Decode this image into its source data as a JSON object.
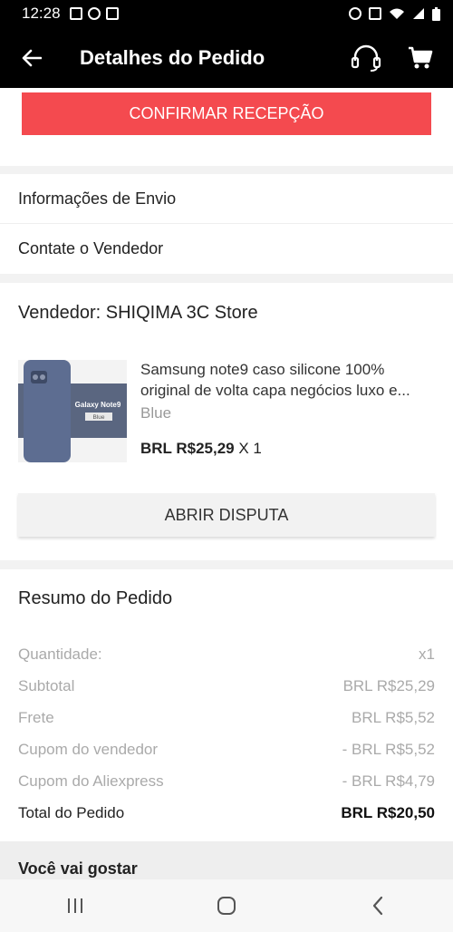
{
  "status_bar": {
    "time": "12:28"
  },
  "app_bar": {
    "title": "Detalhes do Pedido"
  },
  "actions": {
    "confirm_label": "CONFIRMAR RECEPÇÃO"
  },
  "links": [
    {
      "label": "Informações de Envio"
    },
    {
      "label": "Contate o Vendedor"
    }
  ],
  "seller": {
    "name": "Vendedor: SHIQIMA 3C Store",
    "product": {
      "title_line1": "Samsung note9 caso silicone 100%",
      "title_line2": "original de volta capa negócios luxo e...",
      "variant": "Blue",
      "price": "BRL R$25,29",
      "quantity": "X 1",
      "image_caption": "Galaxy Note9",
      "image_badge": "Blue"
    },
    "dispute_label": "ABRIR DISPUTA"
  },
  "summary": {
    "title": "Resumo do Pedido",
    "rows": [
      {
        "label": "Quantidade:",
        "value": "x1"
      },
      {
        "label": "Subtotal",
        "value": "BRL R$25,29"
      },
      {
        "label": "Frete",
        "value": "BRL R$5,52"
      },
      {
        "label": "Cupom do vendedor",
        "value": "- BRL R$5,52"
      },
      {
        "label": "Cupom do Aliexpress",
        "value": "- BRL R$4,79"
      },
      {
        "label": "Total do Pedido",
        "value": "BRL R$20,50"
      }
    ]
  },
  "recommend": {
    "title": "Você vai gostar"
  },
  "colors": {
    "accent": "#f44a4f",
    "appbar": "#000000"
  }
}
